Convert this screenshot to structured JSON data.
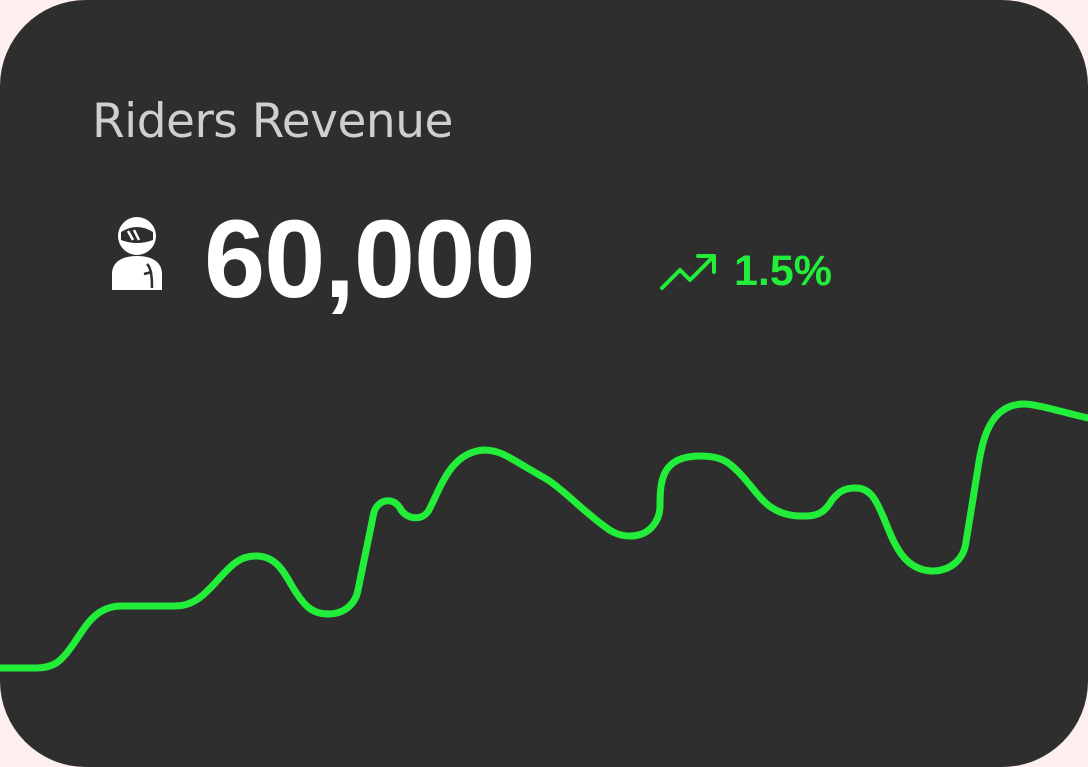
{
  "card": {
    "title": "Riders Revenue",
    "value": "60,000",
    "change": "1.5%",
    "trend_direction": "up",
    "rider_icon": "rider-icon",
    "trend_icon": "trending-up-icon"
  },
  "colors": {
    "card_background": "#2e2e2e",
    "page_background": "#fcefee",
    "title": "#cfcfcf",
    "value": "#ffffff",
    "accent": "#22ee3a"
  }
}
